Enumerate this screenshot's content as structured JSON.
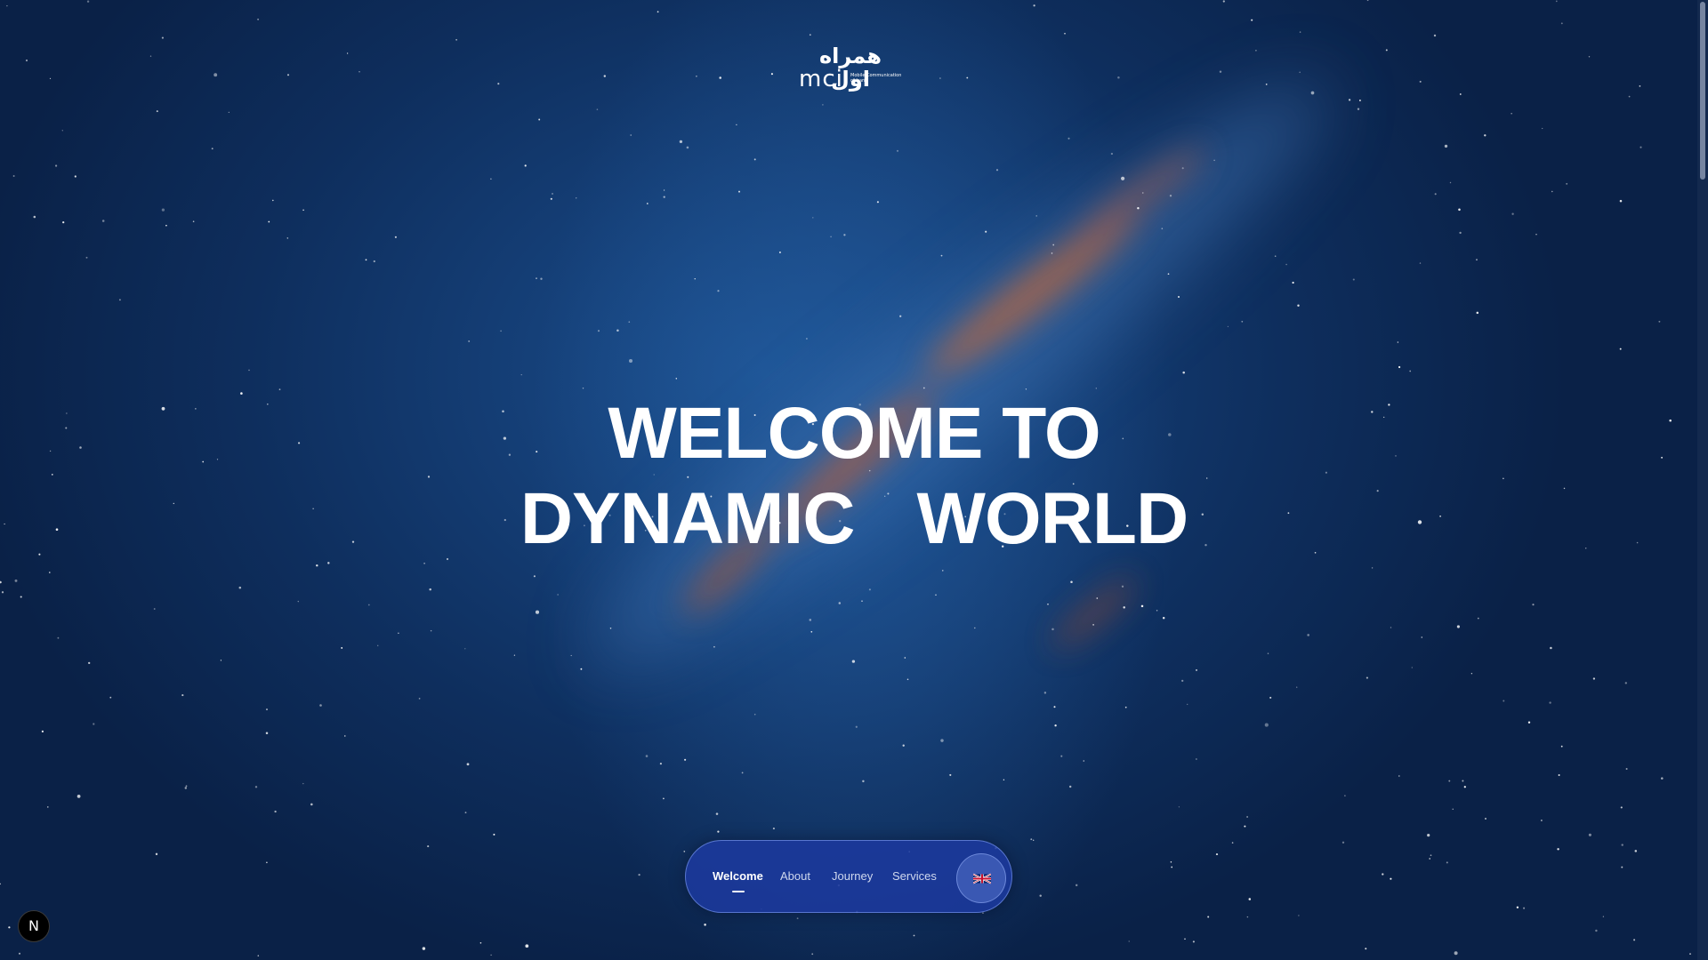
{
  "colors": {
    "background": "#0e2e5d",
    "nav_pill": "#1c3aa0",
    "text": "#ffffff"
  },
  "logo": {
    "persian": "همراه اول",
    "english": "mci",
    "subtitle": "Mobile Communication of Iran"
  },
  "hero": {
    "line1": "WELCOME TO",
    "line2_left": "DYNAMIC",
    "line2_right": "WORLD"
  },
  "nav": {
    "items": [
      {
        "label": "Welcome",
        "active": true
      },
      {
        "label": "About",
        "active": false
      },
      {
        "label": "Journey",
        "active": false
      },
      {
        "label": "Services",
        "active": false
      }
    ],
    "language_icon": "uk-flag-icon"
  },
  "dev_badge": {
    "label": "N",
    "icon": "nextjs-icon"
  }
}
